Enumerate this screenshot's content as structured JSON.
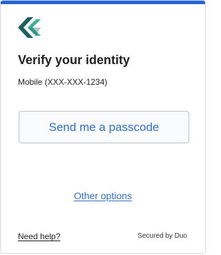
{
  "colors": {
    "accent_bar": "#2563d9",
    "link": "#2f6fd4",
    "logo_dark": "#1b5e63",
    "logo_light": "#3bb39b"
  },
  "logo": {
    "icon": "duo-chevron-logo-icon"
  },
  "header": {
    "title": "Verify your identity"
  },
  "device": {
    "label": "Mobile (XXX-XXX-1234)"
  },
  "actions": {
    "send_passcode_label": "Send me a passcode",
    "other_options_label": "Other options"
  },
  "footer": {
    "help_label": "Need help?",
    "secured_label": "Secured by Duo"
  }
}
